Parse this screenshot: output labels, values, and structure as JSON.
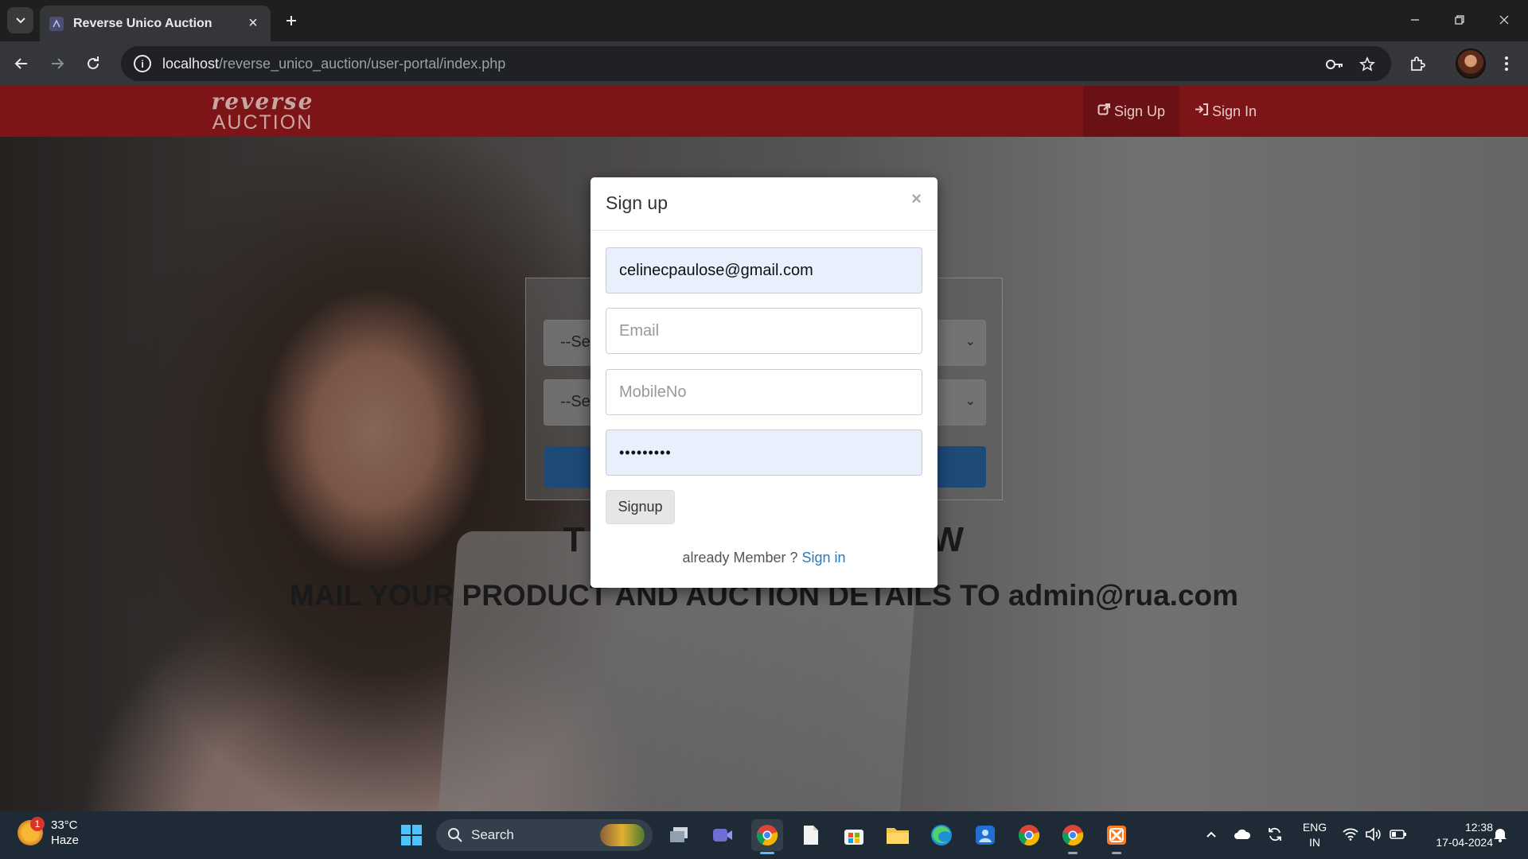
{
  "browser": {
    "tab_title": "Reverse Unico Auction",
    "url_host": "localhost",
    "url_path": "/reverse_unico_auction/user-portal/index.php"
  },
  "site": {
    "logo_top": "reverse",
    "logo_bottom": "AUCTION",
    "nav": [
      {
        "label": "Sign Up",
        "icon": "external-link-icon"
      },
      {
        "label": "Sign In",
        "icon": "sign-in-icon"
      }
    ],
    "select1_value": "--Se",
    "select2_value": "--Se",
    "heading1_left": "T",
    "heading1_right": "W",
    "heading2": "MAIL YOUR PRODUCT AND AUCTION DETAILS TO admin@rua.com"
  },
  "modal": {
    "title": "Sign up",
    "close": "×",
    "name_value": "celinecpaulose@gmail.com",
    "email_placeholder": "Email",
    "mobile_placeholder": "MobileNo",
    "password_mask": "•••••••••",
    "submit_label": "Signup",
    "member_text": "already Member ? ",
    "signin_link": "Sign in"
  },
  "taskbar": {
    "temperature": "33°C",
    "condition": "Haze",
    "weather_badge": "1",
    "search_label": "Search",
    "lang_top": "ENG",
    "lang_bottom": "IN",
    "time": "12:38",
    "date": "17-04-2024"
  },
  "colors": {
    "navbar": "#7d1418",
    "primary_button": "#1e4a78",
    "link": "#2a7ab8",
    "autofill": "#e8f0fe"
  }
}
